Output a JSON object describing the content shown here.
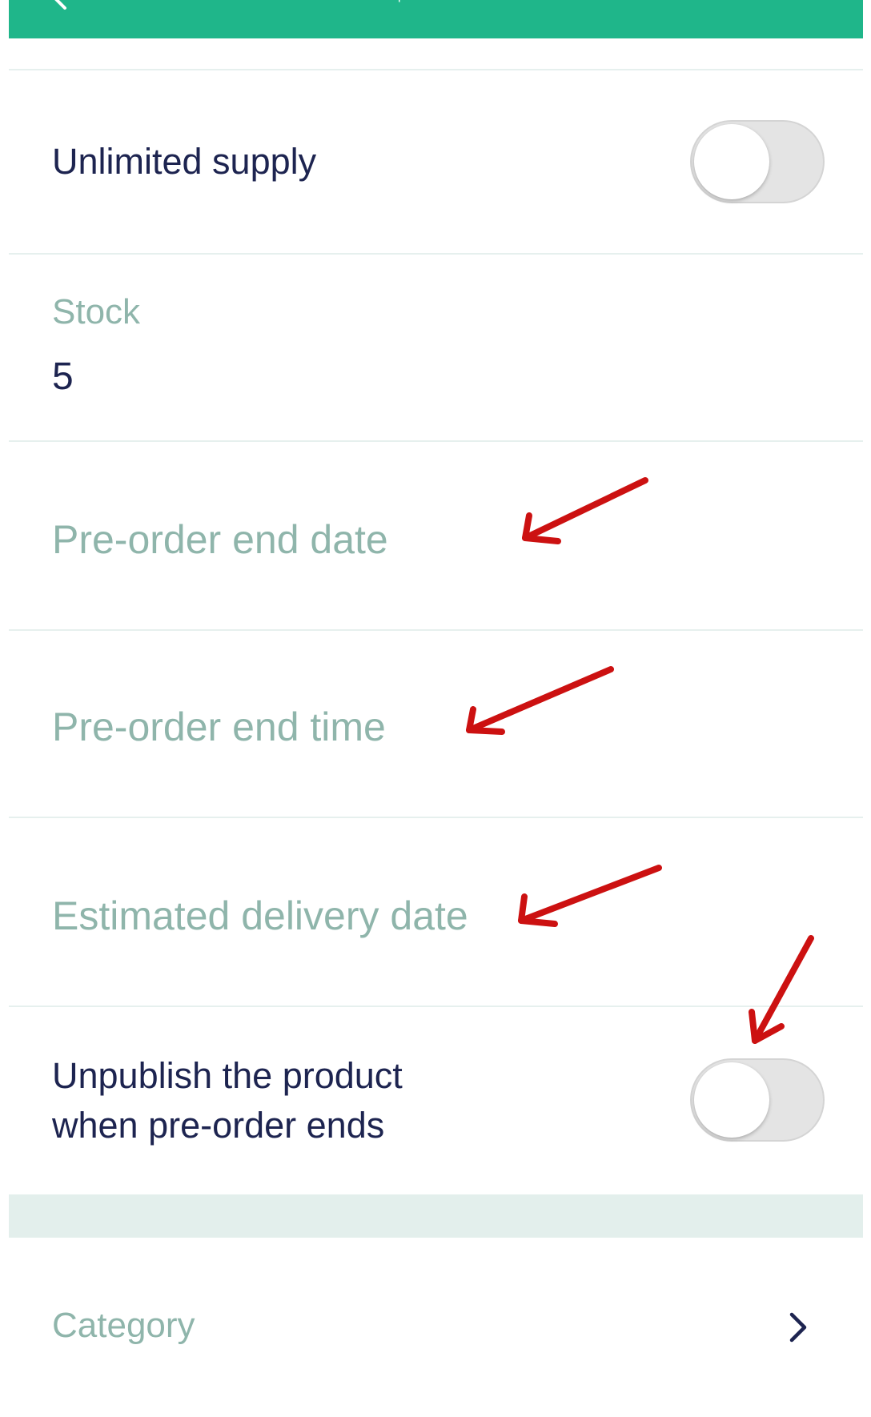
{
  "header": {
    "title_fragment": "p",
    "background_color": "#1fb68a",
    "back_icon": "chevron-left-icon"
  },
  "settings": {
    "unlimited_supply": {
      "label": "Unlimited supply",
      "toggle_on": false
    },
    "stock": {
      "label": "Stock",
      "value": "5"
    },
    "preorder_end_date": {
      "placeholder": "Pre-order end date"
    },
    "preorder_end_time": {
      "placeholder": "Pre-order end time"
    },
    "estimated_delivery_date": {
      "placeholder": "Estimated delivery date"
    },
    "unpublish": {
      "label_line1": "Unpublish the product",
      "label_line2": "when pre-order ends",
      "toggle_on": false
    }
  },
  "category": {
    "label": "Category",
    "chevron_icon": "chevron-right-icon"
  },
  "annotation_color": "#cc1111"
}
